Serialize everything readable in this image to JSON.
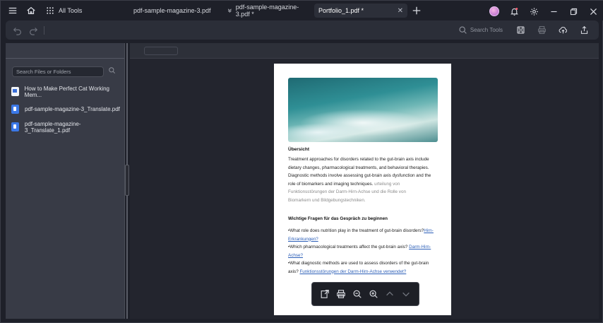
{
  "titlebar": {
    "all_tools": "All Tools",
    "tabs": [
      {
        "label": "pdf-sample-magazine-3.pdf",
        "active": false
      },
      {
        "label": "pdf-sample-magazine-3.pdf *",
        "active": false
      },
      {
        "label": "Portfolio_1.pdf *",
        "active": true
      }
    ],
    "close_glyph": "✕"
  },
  "toolbar": {
    "search_tools": "Search Tools"
  },
  "left_panel": {
    "search_placeholder": "Search Files or Folders",
    "files": [
      {
        "name": "How to Make Perfect Cat Working Mem...",
        "type": "word"
      },
      {
        "name": "pdf-sample-magazine-3_Translate.pdf",
        "type": "pdf"
      },
      {
        "name": "pdf-sample-magazine-3_Translate_1.pdf",
        "type": "pdf"
      }
    ]
  },
  "document": {
    "heading": "Übersicht",
    "overview_lines": [
      "Treatment approaches for disorders related to the gut-brain axis include",
      "dietary changes, pharmacological treatments, and behavioral therapies.",
      "Diagnostic methods involve assessing gut-brain axis dysfunction and the",
      "role of biomarkers and imaging techniques."
    ],
    "overview_ghost_lines": [
      "Funktionsstörungen der Darm-Hirn-Achse und die Rolle von",
      "Biomarkern und Bildgebungstechniken."
    ],
    "overview_ghost_tail": "urteilung von",
    "questions_heading": "Wichtige Fragen für das Gespräch zu beginnen",
    "questions": [
      {
        "text": "•What role does nutrition play in the treatment of gut-brain disorders?",
        "tail": "Hirn-",
        "link_line": "Erkrankungen?"
      },
      {
        "text": "•Which pharmacological treatments affect the gut-brain axis?",
        "tail": "Darm-Hirn-",
        "link_line": "Achse?"
      },
      {
        "text": "•What diagnostic methods are used to assess disorders of the gut-brain",
        "tail": "",
        "link_line": "Funktionsstörungen der Darm-Hirn-Achse verwendet?",
        "link_prefix": "axis?"
      }
    ]
  },
  "colors": {
    "bg": "#1e2029",
    "toolbar": "#2b2e38",
    "panel": "#383b46",
    "link": "#2c5fb8"
  }
}
